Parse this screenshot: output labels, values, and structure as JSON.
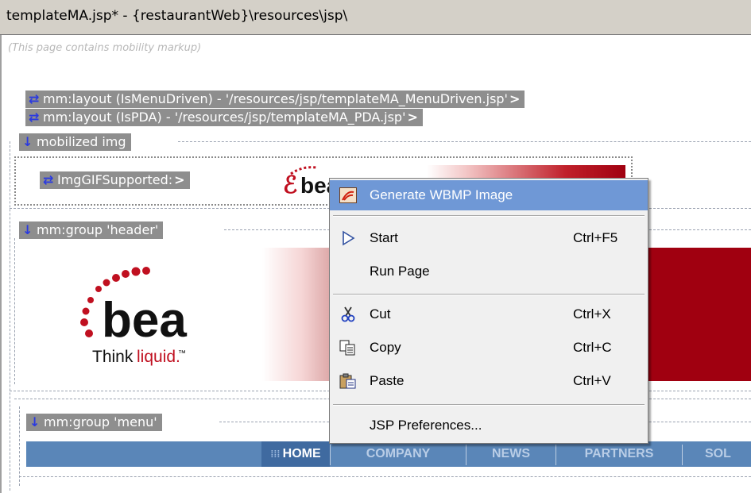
{
  "window": {
    "title": "templateMA.jsp* - {restaurantWeb}\\resources\\jsp\\"
  },
  "canvas": {
    "mobility_note": "(This page contains mobility markup)",
    "tags": {
      "layout_menu": "mm:layout (IsMenuDriven) - '/resources/jsp/templateMA_MenuDriven.jsp'",
      "layout_pda": "mm:layout (IsPDA) - '/resources/jsp/templateMA_PDA.jsp'",
      "mobilized_img": "mobilized img",
      "img_gif": "ImgGIFSupported:",
      "group_header": "mm:group 'header'",
      "group_menu": "mm:group 'menu'"
    },
    "logo": {
      "brand": "bea",
      "tagline_think": "Think",
      "tagline_liquid": "liquid.",
      "tm": "™"
    },
    "nav": {
      "items": [
        "HOME",
        "COMPANY",
        "NEWS",
        "PARTNERS",
        "SOL"
      ],
      "active": "HOME"
    }
  },
  "context_menu": {
    "items": [
      {
        "label": "Generate WBMP Image",
        "shortcut": "",
        "icon": "wbmp-icon",
        "highlighted": true
      },
      {
        "label": "Start",
        "shortcut": "Ctrl+F5",
        "icon": "play-icon"
      },
      {
        "label": "Run Page",
        "shortcut": "",
        "icon": ""
      },
      {
        "label": "Cut",
        "shortcut": "Ctrl+X",
        "icon": "scissors-icon"
      },
      {
        "label": "Copy",
        "shortcut": "Ctrl+C",
        "icon": "copy-icon"
      },
      {
        "label": "Paste",
        "shortcut": "Ctrl+V",
        "icon": "paste-icon"
      },
      {
        "label": "JSP Preferences...",
        "shortcut": "",
        "icon": ""
      }
    ]
  },
  "colors": {
    "tag_bg": "#8e8e8e",
    "menu_highlight": "#6f98d6",
    "nav_bg": "#5a86b8",
    "brand_red": "#a00010"
  }
}
